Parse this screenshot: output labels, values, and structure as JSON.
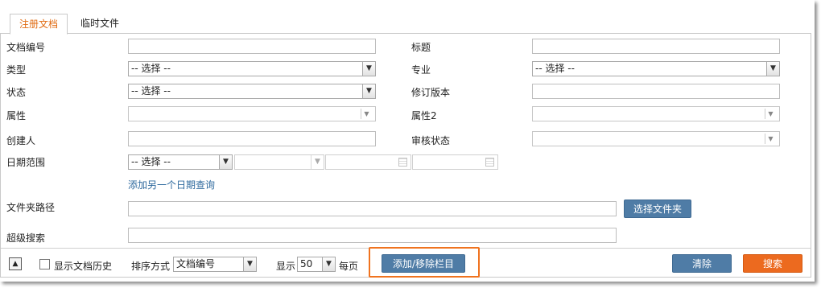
{
  "tabs": [
    {
      "label": "注册文档",
      "active": true
    },
    {
      "label": "临时文件",
      "active": false
    }
  ],
  "form": {
    "doc_number": {
      "label": "文档编号",
      "value": ""
    },
    "title": {
      "label": "标题",
      "value": ""
    },
    "type": {
      "label": "类型",
      "value": "-- 选择 --"
    },
    "major": {
      "label": "专业",
      "value": "-- 选择 --"
    },
    "status": {
      "label": "状态",
      "value": "-- 选择 --"
    },
    "revision": {
      "label": "修订版本",
      "value": ""
    },
    "attribute": {
      "label": "属性",
      "value": ""
    },
    "attribute2": {
      "label": "属性2",
      "value": ""
    },
    "creator": {
      "label": "创建人",
      "value": ""
    },
    "review_status": {
      "label": "审核状态",
      "value": ""
    },
    "date_range": {
      "label": "日期范围",
      "select_value": "-- 选择 --",
      "sub_value": "",
      "from": "",
      "to": ""
    },
    "add_date_query": "添加另一个日期查询",
    "folder_path": {
      "label": "文件夹路径",
      "value": "",
      "button": "选择文件夹"
    },
    "super_search": {
      "label": "超级搜索",
      "value": ""
    }
  },
  "footer": {
    "collapse_icon": "triangle-up-icon",
    "show_history": {
      "label": "显示文档历史",
      "checked": false
    },
    "sort_label": "排序方式",
    "sort_value": "文档编号",
    "show_label": "显示",
    "page_size": "50",
    "per_page": "每页",
    "add_remove_columns": "添加/移除栏目",
    "clear": "清除",
    "search": "搜索"
  },
  "colors": {
    "accent": "#ec6a1f",
    "primary_button": "#4f7ca6",
    "link": "#2f6a9e",
    "highlight_border": "#f0731f"
  }
}
